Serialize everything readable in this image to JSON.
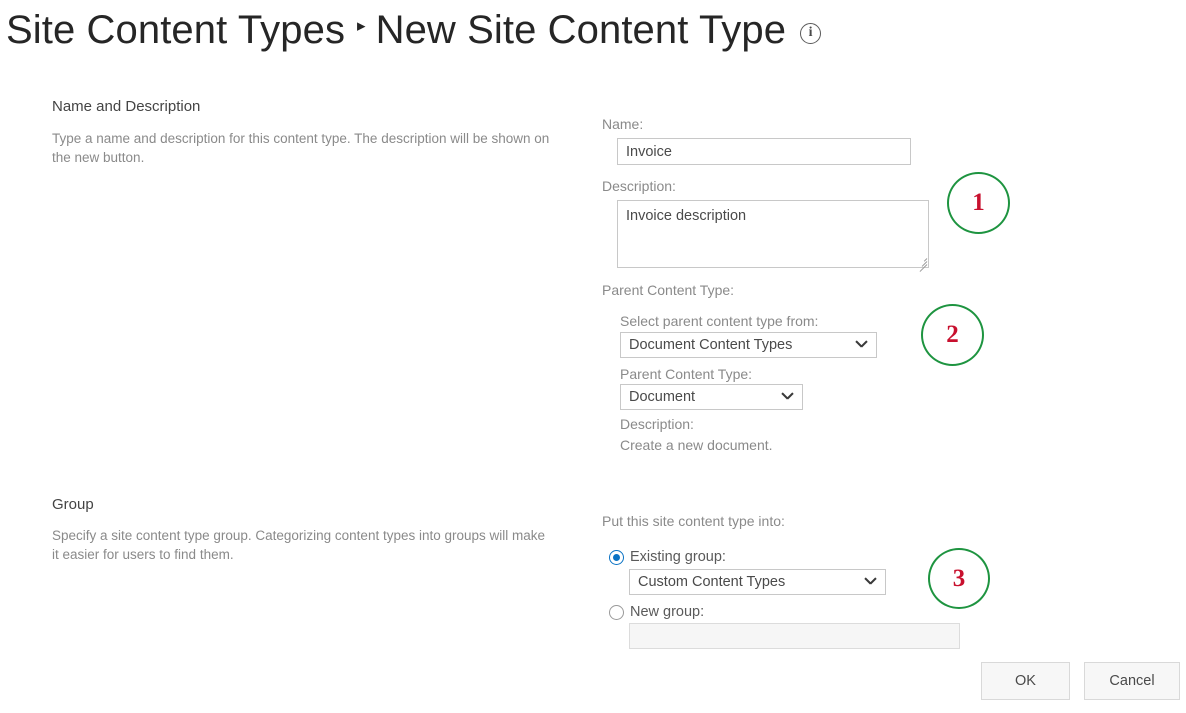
{
  "header": {
    "breadcrumb_parent": "Site Content Types",
    "separator": "▸",
    "title": "New Site Content Type",
    "info_icon": "i"
  },
  "sections": {
    "name_and_description": {
      "title": "Name and Description",
      "description": "Type a name and description for this content type. The description will be shown on the new button."
    },
    "group": {
      "title": "Group",
      "description": "Specify a site content type group. Categorizing content types into groups will make it easier for users to find them."
    }
  },
  "form": {
    "name_label": "Name:",
    "name_value": "Invoice",
    "name_placeholder": "",
    "description_label": "Description:",
    "description_value": "Invoice description",
    "description_placeholder": "",
    "parent_content_type_label": "Parent Content Type:",
    "select_parent_from_label": "Select parent content type from:",
    "select_parent_from_value": "Document Content Types",
    "parent_type_label": "Parent Content Type:",
    "parent_type_value": "Document",
    "parent_description_label": "Description:",
    "parent_description_value": "Create a new document.",
    "put_into_label": "Put this site content type into:",
    "existing_group_label": "Existing group:",
    "existing_group_value": "Custom Content Types",
    "new_group_label": "New group:",
    "new_group_value": "",
    "new_group_placeholder": "",
    "existing_group_selected": true
  },
  "buttons": {
    "ok": "OK",
    "cancel": "Cancel"
  },
  "annotations": [
    {
      "number": "1"
    },
    {
      "number": "2"
    },
    {
      "number": "3"
    }
  ],
  "colors": {
    "annotation_ring": "#1e9440",
    "annotation_number": "#c8102e",
    "radio_selected": "#0a72c4",
    "title_text": "#262626",
    "label_text": "#8a8a8a"
  }
}
